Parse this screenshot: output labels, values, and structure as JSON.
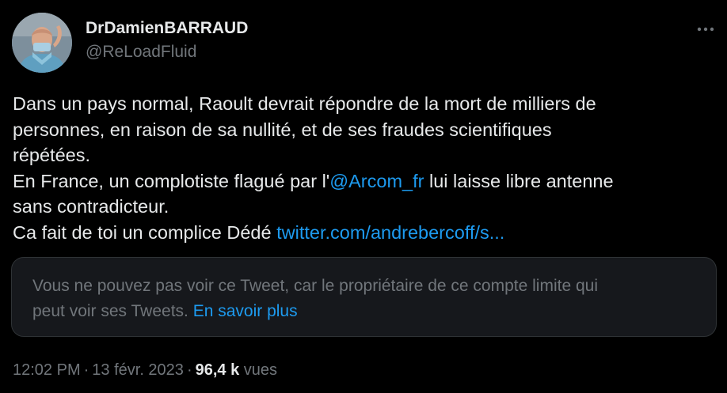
{
  "author": {
    "display_name": "DrDamienBARRAUD",
    "handle": "@ReLoadFluid"
  },
  "icons": {
    "more": "more-options-icon",
    "avatar": "profile-photo"
  },
  "tweet": {
    "lines": [
      {
        "text": "Dans un pays normal, Raoult devrait répondre de la mort de milliers de"
      },
      {
        "text": "personnes, en raison de sa nullité, et de ses fraudes scientifiques"
      },
      {
        "text": "répétées."
      },
      {
        "before": "En France, un complotiste flagué par l'",
        "mention": "@Arcom_fr",
        "after": " lui laisse libre antenne"
      },
      {
        "text": "sans contradicteur."
      },
      {
        "before": "Ca fait de toi un complice Dédé ",
        "link": "twitter.com/andrebercoff/s..."
      }
    ]
  },
  "quote_notice": {
    "line1": "Vous ne pouvez pas voir ce Tweet, car le propriétaire de ce compte limite qui",
    "line2_text": "peut voir ses Tweets.",
    "learn_more": "En savoir plus"
  },
  "meta": {
    "time": "12:02 PM",
    "separator": "·",
    "date": "13 févr. 2023",
    "views_count": "96,4 k",
    "views_label": "vues"
  },
  "colors": {
    "background": "#000000",
    "text": "#e7e9ea",
    "secondary": "#71767b",
    "accent": "#1d9bf0",
    "card": "#16181c",
    "border": "#2f3336"
  }
}
